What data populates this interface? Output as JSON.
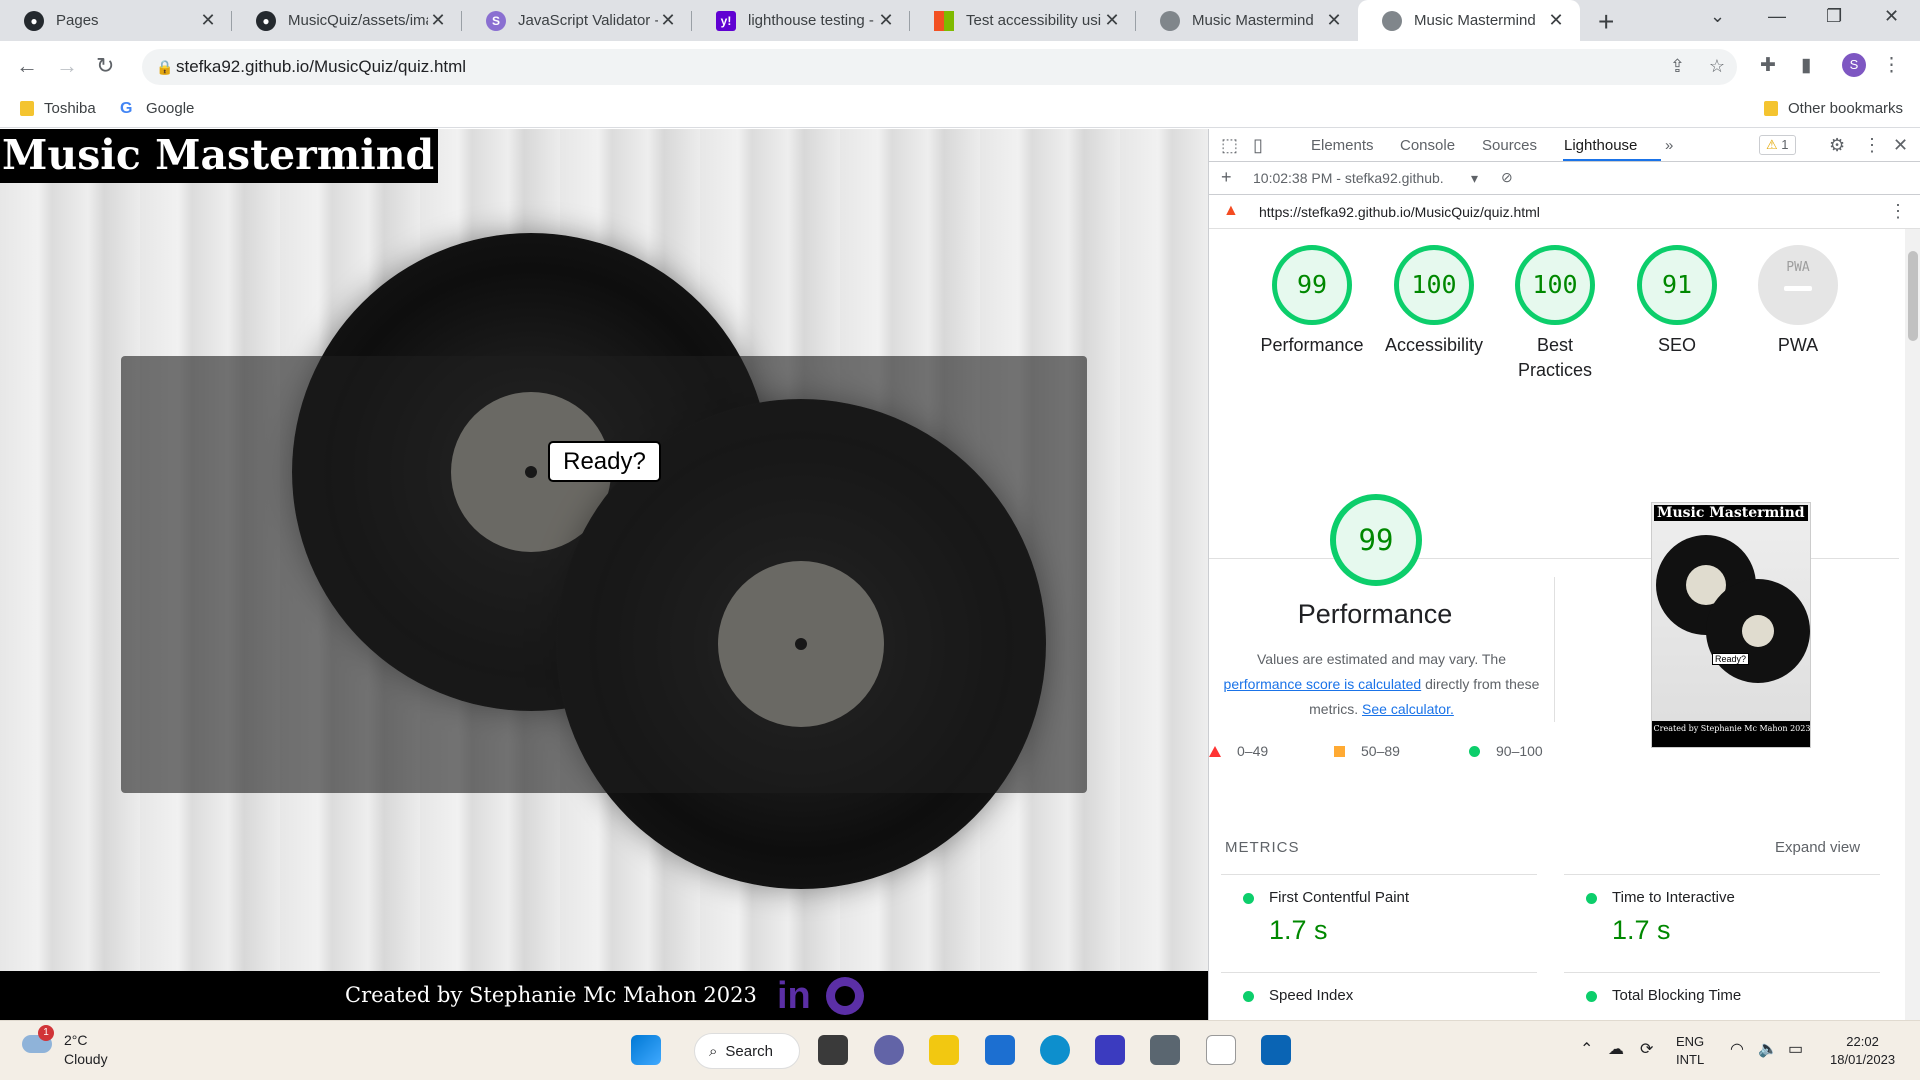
{
  "browser": {
    "tabs": [
      {
        "title": "Pages",
        "icon": "github-icon"
      },
      {
        "title": "MusicQuiz/assets/ima",
        "icon": "github-icon"
      },
      {
        "title": "JavaScript Validator -",
        "icon": "jshint-icon"
      },
      {
        "title": "lighthouse testing - Y",
        "icon": "yahoo-icon"
      },
      {
        "title": "Test accessibility usin",
        "icon": "microsoft-icon"
      },
      {
        "title": "Music Mastermind",
        "icon": "globe-icon"
      },
      {
        "title": "Music Mastermind",
        "icon": "globe-icon"
      }
    ],
    "url": "stefka92.github.io/MusicQuiz/quiz.html",
    "profile_initial": "S",
    "bookmarks": [
      "Toshiba",
      "Google"
    ],
    "other_bookmarks": "Other bookmarks"
  },
  "page": {
    "title": "Music Mastermind",
    "ready_button": "Ready?",
    "footer_text": "Created by Stephanie Mc Mahon 2023",
    "linkedin_label": "in"
  },
  "devtools": {
    "tabs": [
      "Elements",
      "Console",
      "Sources",
      "Lighthouse"
    ],
    "active_tab": "Lighthouse",
    "more_tabs": "»",
    "warning_count": "1",
    "report_time": "10:02:38 PM - stefka92.github.",
    "report_url": "https://stefka92.github.io/MusicQuiz/quiz.html",
    "scores": [
      {
        "label": "Performance",
        "value": "99"
      },
      {
        "label": "Accessibility",
        "value": "100"
      },
      {
        "label": "Best Practices",
        "value": "100"
      },
      {
        "label": "SEO",
        "value": "91"
      },
      {
        "label": "PWA",
        "value": "PWA"
      }
    ],
    "performance": {
      "score": "99",
      "title": "Performance",
      "desc_1": "Values are estimated and may vary. The",
      "desc_link": "performance score is calculated",
      "desc_2": " directly from these",
      "desc_3": "metrics. ",
      "calc_link": "See calculator."
    },
    "legend": [
      "0–49",
      "50–89",
      "90–100"
    ],
    "thumbnail": {
      "title": "Music Mastermind",
      "ready": "Ready?",
      "footer": "Created by Stephanie Mc Mahon 2023"
    },
    "metrics_heading": "METRICS",
    "expand_view": "Expand view",
    "metrics": [
      {
        "label": "First Contentful Paint",
        "value": "1.7 s"
      },
      {
        "label": "Time to Interactive",
        "value": "1.7 s"
      },
      {
        "label": "Speed Index",
        "value": ""
      },
      {
        "label": "Total Blocking Time",
        "value": ""
      }
    ],
    "colors": {
      "pass": "#0cce6b",
      "average": "#ffaa33",
      "fail": "#ff3333"
    }
  },
  "taskbar": {
    "weather_temp": "2°C",
    "weather_desc": "Cloudy",
    "weather_badge": "1",
    "search_label": "Search",
    "lang_1": "ENG",
    "lang_2": "INTL",
    "time": "22:02",
    "date": "18/01/2023"
  }
}
